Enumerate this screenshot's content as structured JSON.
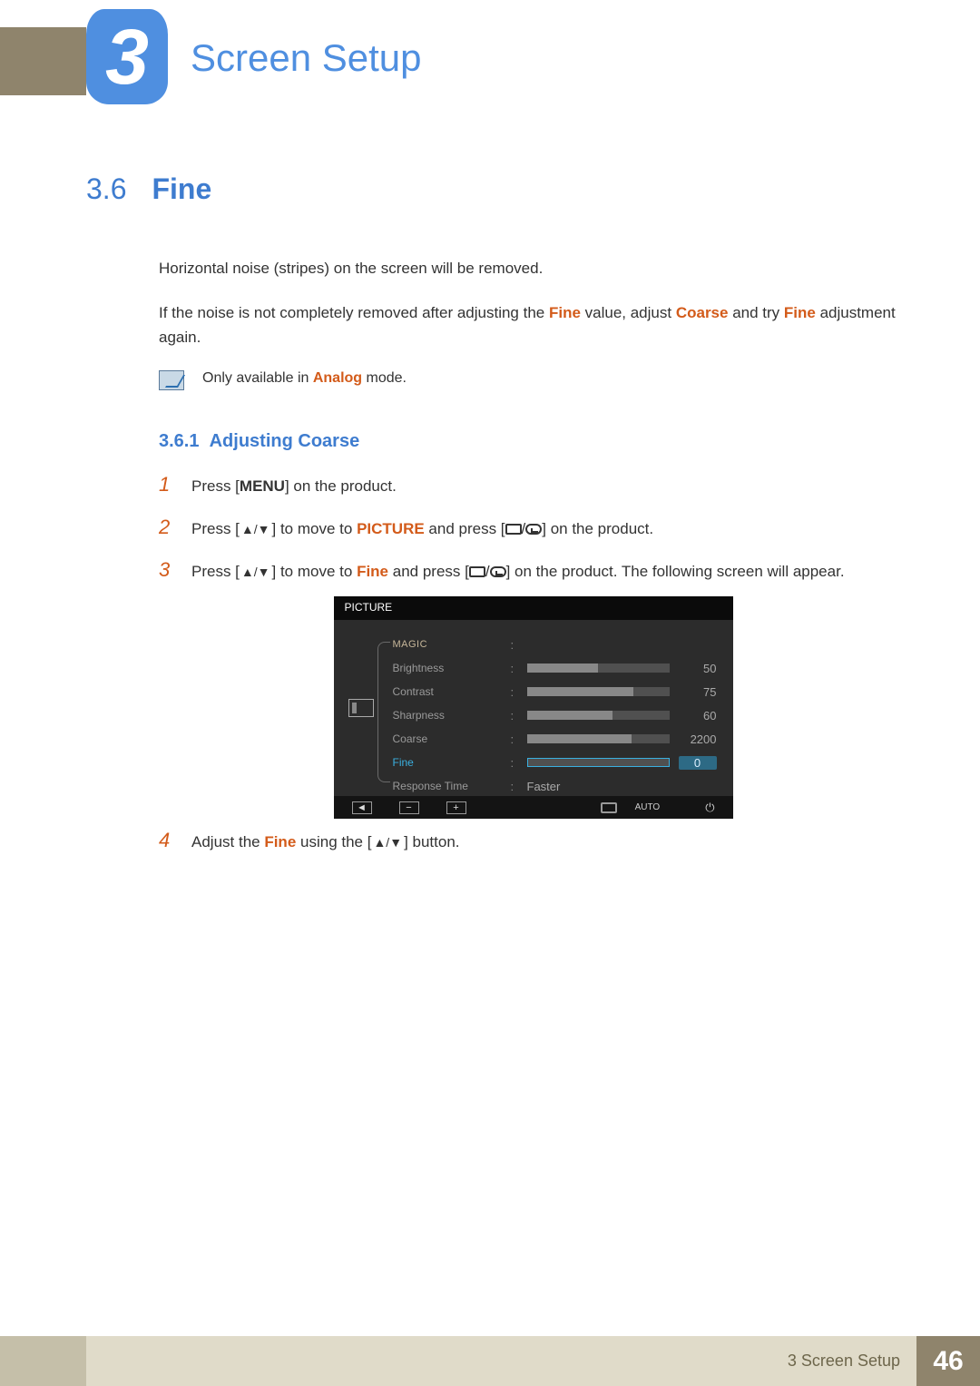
{
  "chapter": {
    "number": "3",
    "title": "Screen Setup"
  },
  "section": {
    "number": "3.6",
    "title": "Fine"
  },
  "intro": {
    "line1": "Horizontal noise (stripes) on the screen will be removed.",
    "line2a": "If the noise is not completely removed after adjusting the ",
    "kw_fine": "Fine",
    "line2b": " value, adjust ",
    "kw_coarse": "Coarse",
    "line2c": " and try ",
    "line2d": " adjustment again."
  },
  "note": {
    "pre": "Only available in ",
    "kw": "Analog",
    "post": " mode."
  },
  "subsection": {
    "number": "3.6.1",
    "title": "Adjusting Coarse"
  },
  "steps": {
    "s1": {
      "n": "1",
      "a": "Press [",
      "menu": "MENU",
      "b": "] on the product."
    },
    "s2": {
      "n": "2",
      "a": "Press [",
      "arrows": "▲/▼",
      "b": "] to move to ",
      "kw": "PICTURE",
      "c": " and press [",
      "d": "] on the product."
    },
    "s3": {
      "n": "3",
      "a": "Press [",
      "arrows": "▲/▼",
      "b": "] to move to ",
      "kw": "Fine",
      "c": " and press [",
      "d": "] on the product. The following screen will appear."
    },
    "s4": {
      "n": "4",
      "a": "Adjust the ",
      "kw": "Fine",
      "b": " using the [",
      "arrows": "▲/▼",
      "c": "] button."
    }
  },
  "osd": {
    "header": "PICTURE",
    "rows": [
      {
        "label": "MAGIC",
        "type": "blank",
        "class": "magic"
      },
      {
        "label": "Brightness",
        "type": "bar",
        "value": 50,
        "max": 100
      },
      {
        "label": "Contrast",
        "type": "bar",
        "value": 75,
        "max": 100
      },
      {
        "label": "Sharpness",
        "type": "bar",
        "value": 60,
        "max": 100
      },
      {
        "label": "Coarse",
        "type": "bar",
        "value": 2200,
        "max": 3000
      },
      {
        "label": "Fine",
        "type": "bar",
        "value": 0,
        "max": 100,
        "active": true
      },
      {
        "label": "Response Time",
        "type": "text",
        "text": "Faster"
      }
    ],
    "footer": {
      "back": "◄",
      "minus": "−",
      "plus": "+",
      "auto": "AUTO",
      "power": "⏻"
    }
  },
  "footer": {
    "chapter_ref": "3 Screen Setup",
    "page": "46"
  }
}
